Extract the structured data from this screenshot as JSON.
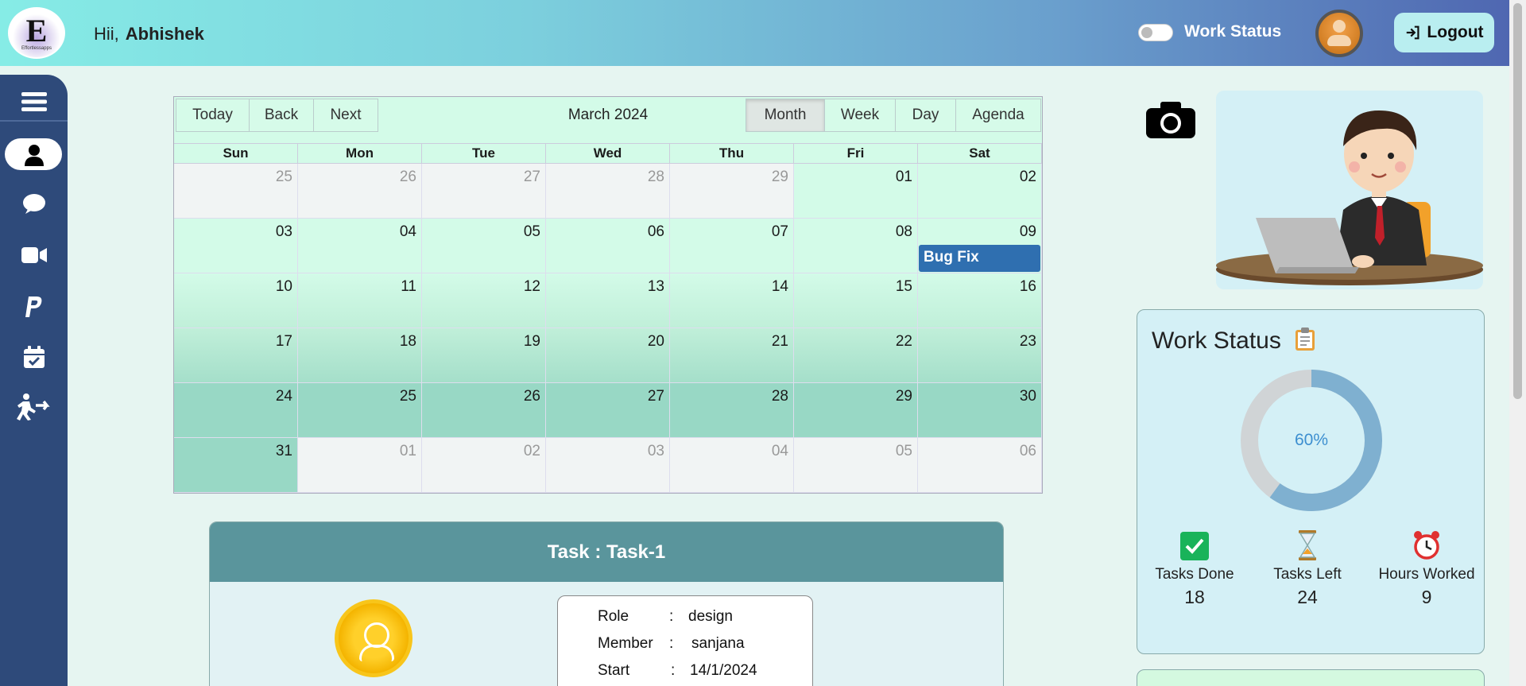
{
  "header": {
    "logo_letter": "E",
    "logo_text": "Effortlessapps",
    "greeting": "Hii,",
    "user_name": "Abhishek",
    "work_status_label": "Work Status",
    "logout_label": "Logout"
  },
  "sidebar": {
    "items": [
      {
        "name": "menu-icon"
      },
      {
        "name": "profile-icon"
      },
      {
        "name": "chat-icon"
      },
      {
        "name": "video-icon"
      },
      {
        "name": "paypal-icon"
      },
      {
        "name": "calendar-check-icon"
      },
      {
        "name": "exit-icon"
      }
    ]
  },
  "calendar": {
    "title": "March 2024",
    "nav": [
      "Today",
      "Back",
      "Next"
    ],
    "views": [
      "Month",
      "Week",
      "Day",
      "Agenda"
    ],
    "active_view": "Month",
    "weekdays": [
      "Sun",
      "Mon",
      "Tue",
      "Wed",
      "Thu",
      "Fri",
      "Sat"
    ],
    "weeks": [
      [
        "25",
        "26",
        "27",
        "28",
        "29",
        "01",
        "02"
      ],
      [
        "03",
        "04",
        "05",
        "06",
        "07",
        "08",
        "09"
      ],
      [
        "10",
        "11",
        "12",
        "13",
        "14",
        "15",
        "16"
      ],
      [
        "17",
        "18",
        "19",
        "20",
        "21",
        "22",
        "23"
      ],
      [
        "24",
        "25",
        "26",
        "27",
        "28",
        "29",
        "30"
      ],
      [
        "31",
        "01",
        "02",
        "03",
        "04",
        "05",
        "06"
      ]
    ],
    "event": {
      "label": "Bug Fix"
    }
  },
  "task": {
    "title": "Task : Task-1",
    "details": [
      {
        "key": "Role",
        "value": "design"
      },
      {
        "key": "Member",
        "value": "sanjana"
      },
      {
        "key": "Start",
        "value": "14/1/2024"
      }
    ]
  },
  "work_status": {
    "title": "Work Status",
    "percent": 60,
    "percent_label": "60%",
    "stats": [
      {
        "label": "Tasks Done",
        "value": "18",
        "icon": "checkbox-icon"
      },
      {
        "label": "Tasks Left",
        "value": "24",
        "icon": "hourglass-icon"
      },
      {
        "label": "Hours Worked",
        "value": "9",
        "icon": "alarm-clock-icon"
      }
    ]
  },
  "colors": {
    "sidebar": "#2e4a7a",
    "event": "#2f6fb0",
    "task_header": "#5a959c",
    "donut_progress": "#7fb0d0",
    "donut_track": "#d0d4d6"
  }
}
